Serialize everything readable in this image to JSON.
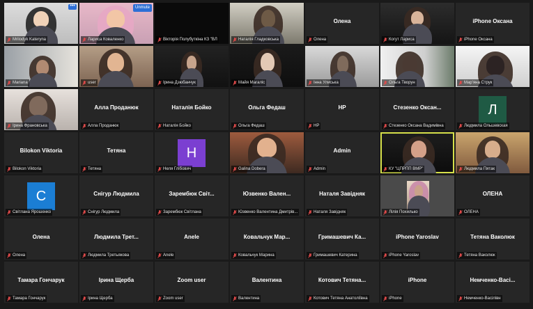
{
  "ui": {
    "unmute_label": "Unmute",
    "more_label": "•••"
  },
  "colors": {
    "mic_muted": "#e04a4a",
    "active_speaker": "#d6e04a",
    "avatar_green": "#1f5a44",
    "avatar_purple": "#7b3fd1",
    "avatar_blue": "#1b7ed4"
  },
  "participants": [
    {
      "label": "Mrilodyk Kateryna",
      "kind": "video"
    },
    {
      "label": "Лариса Коваленко",
      "kind": "video"
    },
    {
      "label": "Вікторія Полубуткіна КЗ \"ВЛ",
      "kind": "blank"
    },
    {
      "label": "Наталія Гладковська",
      "kind": "video"
    },
    {
      "name": "Олена",
      "label": "Олена",
      "kind": "name"
    },
    {
      "label": "Когут Лариса",
      "kind": "video"
    },
    {
      "name": "iPhone Оксана",
      "label": "iPhone Оксана",
      "kind": "name"
    },
    {
      "label": "Mariana",
      "kind": "video"
    },
    {
      "label": "user",
      "kind": "video"
    },
    {
      "label": "Ірина Дзюбанчук",
      "kind": "video"
    },
    {
      "label": "Майя Магаліс",
      "kind": "video"
    },
    {
      "label": "Інна Улиська",
      "kind": "video"
    },
    {
      "label": "Ольга Творун",
      "kind": "video"
    },
    {
      "label": "Мар'яна Струк",
      "kind": "video"
    },
    {
      "label": "Ірина Франовська",
      "kind": "video"
    },
    {
      "name": "Алла Проданюк",
      "label": "Алла Проданюк",
      "kind": "name"
    },
    {
      "name": "Наталія Бойко",
      "label": "Наталія Бойко",
      "kind": "name"
    },
    {
      "name": "Ольга Федаш",
      "label": "Ольга Федаш",
      "kind": "name"
    },
    {
      "name": "HP",
      "label": "HP",
      "kind": "name"
    },
    {
      "name": "Стезенко Оксан...",
      "label": "Стезенко Оксана Вадимівна",
      "kind": "name"
    },
    {
      "avatar": "Л",
      "label": "Людмила Ольшевская",
      "kind": "avatar"
    },
    {
      "name": "Bilokon Viktoria",
      "label": "Bilokon Viktoria",
      "kind": "name"
    },
    {
      "name": "Тетяна",
      "label": "Тетяна",
      "kind": "name"
    },
    {
      "avatar": "H",
      "label": "Неля Глібович",
      "kind": "avatar"
    },
    {
      "label": "Galina Dobera",
      "kind": "video"
    },
    {
      "name": "Admin",
      "label": "Admin",
      "kind": "name"
    },
    {
      "label": "КУ \"ЦПРПП ВМР\"",
      "kind": "video"
    },
    {
      "label": "Людмила Пятак",
      "kind": "video"
    },
    {
      "avatar": "C",
      "label": "Світлана Ярошенко",
      "kind": "avatar"
    },
    {
      "name": "Снігур Людмила",
      "label": "Снігур Людмила",
      "kind": "name"
    },
    {
      "name": "Зарембюк Світ...",
      "label": "Зарембюк Світлана",
      "kind": "name"
    },
    {
      "name": "Юзвенко Вален...",
      "label": "Юзвенко Валентина Дмитрів...",
      "kind": "name"
    },
    {
      "name": "Наталя Завідняк",
      "label": "Наталя Завідняк",
      "kind": "name"
    },
    {
      "label": "Лілія Похилько",
      "kind": "video"
    },
    {
      "name": "ОЛЕНА",
      "label": "ОЛЕНА",
      "kind": "name"
    },
    {
      "name": "Олена",
      "label": "Олена",
      "kind": "name"
    },
    {
      "name": "Людмила Трет...",
      "label": "Людмила Третьякова",
      "kind": "name"
    },
    {
      "name": "Anele",
      "label": "Anele",
      "kind": "name"
    },
    {
      "name": "Ковальчук Мар...",
      "label": "Ковальчук Марина",
      "kind": "name"
    },
    {
      "name": "Гримашевич Ка...",
      "label": "Гримашевич Катерина",
      "kind": "name"
    },
    {
      "name": "iPhone Yaroslav",
      "label": "iPhone Yaroslav",
      "kind": "name"
    },
    {
      "name": "Тетяна Ваколюк",
      "label": "Тетяна Ваколюк",
      "kind": "name"
    },
    {
      "name": "Тамара Гончарук",
      "label": "Тамара Гончарук",
      "kind": "name"
    },
    {
      "name": "Ірина Щерба",
      "label": "Ірина Щерба",
      "kind": "name"
    },
    {
      "name": "Zoom user",
      "label": "Zoom user",
      "kind": "name"
    },
    {
      "name": "Валентина",
      "label": "Валентина",
      "kind": "name"
    },
    {
      "name": "Котович Тетяна...",
      "label": "Котович Тетяна Анатоліївна",
      "kind": "name"
    },
    {
      "name": "iPhone",
      "label": "iPhone",
      "kind": "name"
    },
    {
      "name": "Немченко-Васі...",
      "label": "Немченко-Васілівн",
      "kind": "name"
    }
  ]
}
